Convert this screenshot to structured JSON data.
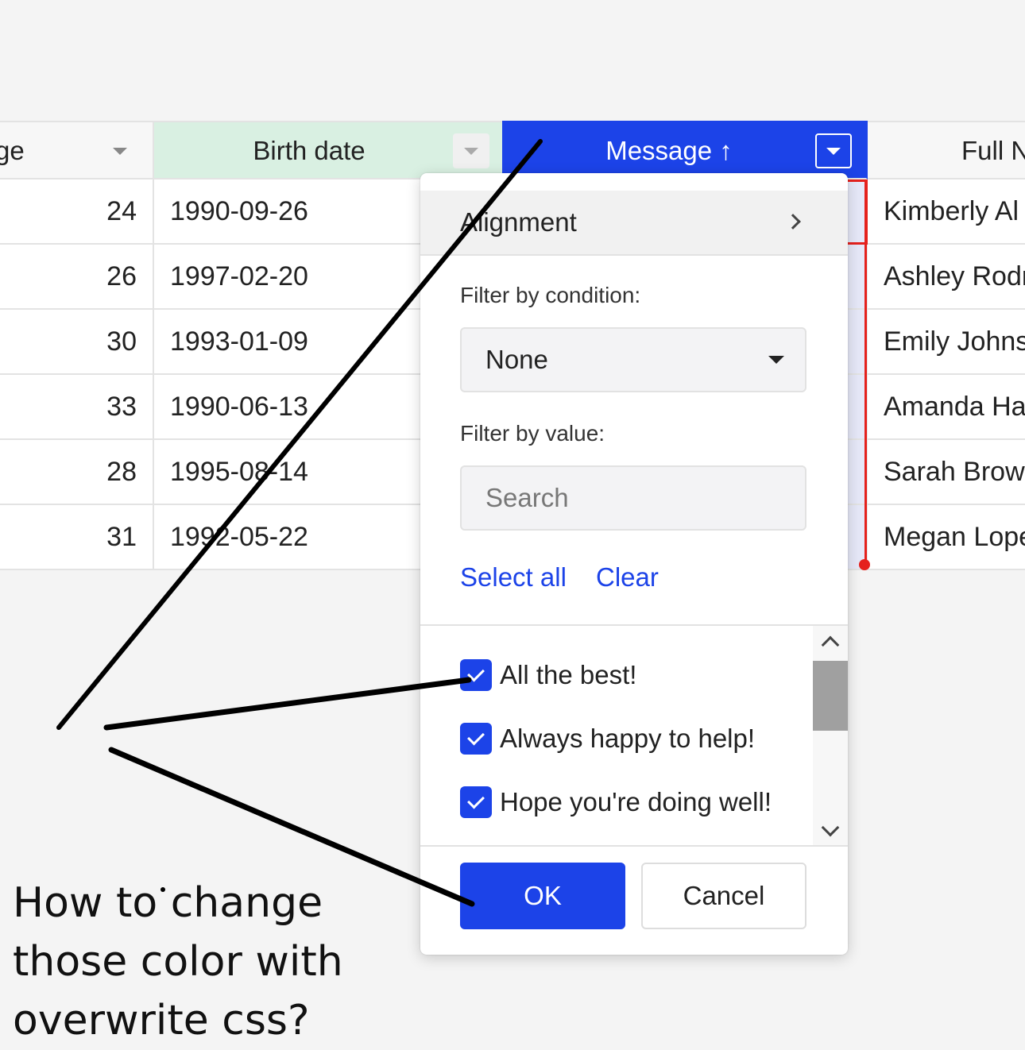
{
  "grid": {
    "headers": {
      "age": "ge",
      "birth": "Birth date",
      "message": "Message ↑",
      "full": "Full N"
    },
    "rows": [
      {
        "age": "24",
        "birth": "1990-09-26",
        "full": "Kimberly Al"
      },
      {
        "age": "26",
        "birth": "1997-02-20",
        "full": "Ashley Rodr"
      },
      {
        "age": "30",
        "birth": "1993-01-09",
        "full": "Emily Johns"
      },
      {
        "age": "33",
        "birth": "1990-06-13",
        "full": "Amanda Ha"
      },
      {
        "age": "28",
        "birth": "1995-08-14",
        "full": "Sarah Brow"
      },
      {
        "age": "31",
        "birth": "1992-05-22",
        "full": "Megan Lope"
      }
    ]
  },
  "filter_menu": {
    "alignment": "Alignment",
    "filter_by_condition": "Filter by condition:",
    "condition_value": "None",
    "filter_by_value": "Filter by value:",
    "search_placeholder": "Search",
    "select_all": "Select all",
    "clear": "Clear",
    "items": [
      {
        "label": "All the best!",
        "checked": true
      },
      {
        "label": "Always happy to help!",
        "checked": true
      },
      {
        "label": "Hope you're doing well!",
        "checked": true
      }
    ],
    "ok": "OK",
    "cancel": "Cancel"
  },
  "annotation": {
    "question": "How to change those color with overwrite css?"
  },
  "colors": {
    "accent": "#1c43e8",
    "selection": "#e5211d",
    "birth_header": "#d9f0e2"
  },
  "icons": [
    "chevron-down-icon",
    "chevron-right-icon",
    "checkbox-checked-icon",
    "scroll-up-icon",
    "scroll-down-icon"
  ]
}
